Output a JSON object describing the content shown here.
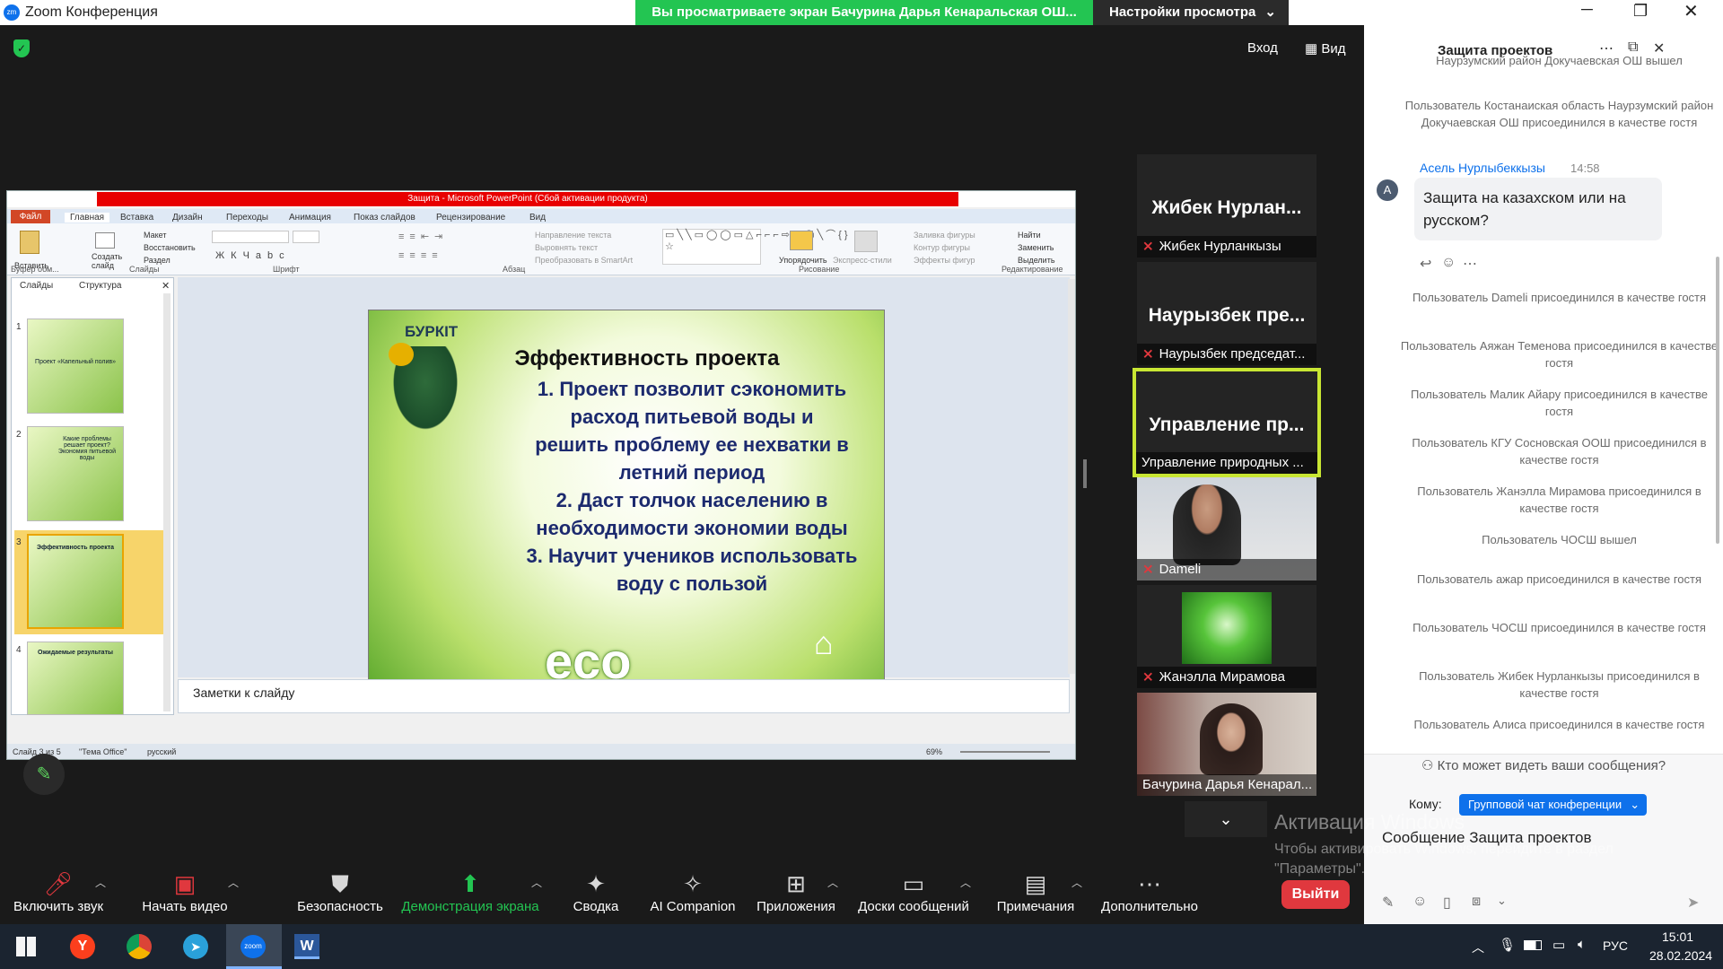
{
  "window": {
    "title": "Zoom Конференция",
    "share_banner": "Вы просматриваете экран Бачурина Дарья Кенаральская ОШ...",
    "view_settings": "Настройки просмотра",
    "enter_label": "Вход",
    "view_label": "Вид"
  },
  "ppt": {
    "title": "Защита - Microsoft PowerPoint (Сбой активации продукта)",
    "tabs": [
      "Файл",
      "Главная",
      "Вставка",
      "Дизайн",
      "Переходы",
      "Анимация",
      "Показ слайдов",
      "Рецензирование",
      "Вид"
    ],
    "group_labels": [
      "Буфер обм...",
      "Слайды",
      "Шрифт",
      "Абзац",
      "Рисование",
      "Редактирование"
    ],
    "panel_tabs": [
      "Слайды",
      "Структура"
    ],
    "ribbon": {
      "paste": "Вставить",
      "create_slide": "Создать слайд",
      "layout": "Макет",
      "restore": "Восстановить",
      "section": "Раздел",
      "text_direction": "Направление текста",
      "align_text": "Выровнять текст",
      "smartart": "Преобразовать в SmartArt",
      "arrange": "Упорядочить",
      "quick_styles": "Экспресс-стили",
      "shape_fill": "Заливка фигуры",
      "shape_outline": "Контур фигуры",
      "shape_effects": "Эффекты фигур",
      "find": "Найти",
      "replace": "Заменить",
      "select": "Выделить"
    },
    "thumbs": [
      {
        "num": "1",
        "text": "Проект «Капельный полив»"
      },
      {
        "num": "2",
        "text": "Какие проблемы решает проект? Экономия питьевой воды"
      },
      {
        "num": "3",
        "text": "Эффективность проекта"
      },
      {
        "num": "4",
        "text": "Ожидаемые результаты"
      }
    ],
    "slide": {
      "logo": "БУРКІТ",
      "title": "Эффективность проекта",
      "lines": [
        "1.  Проект позволит сэкономить",
        "расход питьевой воды и",
        "решить проблему ее нехватки в",
        "летний период",
        "2.  Даст толчок населению в",
        "необходимости экономии воды",
        "3.  Научит учеников использовать",
        "воду с пользой"
      ],
      "eco": "eco"
    },
    "notes": "Заметки к слайду",
    "status": {
      "slide": "Слайд 3 из 5",
      "theme": "\"Тема Office\"",
      "lang": "русский",
      "zoom": "69%"
    }
  },
  "participants": [
    {
      "big": "Жибек Нурлан...",
      "name": "Жибек Нурланкызы"
    },
    {
      "big": "Наурызбек пре...",
      "name": "Наурызбек председат..."
    },
    {
      "big": "Управление пр...",
      "name": "Управление природных ..."
    },
    {
      "name": "Dameli"
    },
    {
      "name": "Жанэлла Мирамова"
    },
    {
      "name": "Бачурина Дарья Кенарал..."
    }
  ],
  "chat": {
    "title": "Защита проектов",
    "sender": "Асель Нурлыбеккызы",
    "time": "14:58",
    "avatar": "А",
    "message": "Защита на казахском или на русском?",
    "messages": [
      "Наурзумский район Докучаевская ОШ вышел",
      "Пользователь Костанаиская область Наурзумский район Докучаевская ОШ присоединился в качестве гостя",
      "Пользователь Dameli присоединился в качестве гостя",
      "Пользователь Аяжан Теменова присоединился в качестве гостя",
      "Пользователь Малик Айару присоединился в качестве гостя",
      "Пользователь КГУ Сосновская ООШ присоединился в качестве гостя",
      "Пользователь Жанэлла Мирамова присоединился в качестве гостя",
      "Пользователь ЧОСШ вышел",
      "Пользователь ажар присоединился в качестве гостя",
      "Пользователь ЧОСШ присоединился в качестве гостя",
      "Пользователь Жибек Нурланкызы присоединился в качестве гостя",
      "Пользователь Алиса присоединился в качестве гостя"
    ],
    "who_can_see": "Кто может видеть ваши сообщения?",
    "to_label": "Кому:",
    "to_value": "Групповой чат конференции",
    "placeholder": "Сообщение Защита проектов"
  },
  "activation": {
    "title": "Активация Windows",
    "text": "Чтобы активировать Windows, перейдите в раздел \"Параметры\"."
  },
  "toolbar": {
    "mic": "Включить звук",
    "video": "Начать видео",
    "security": "Безопасность",
    "share": "Демонстрация экрана",
    "summary": "Сводка",
    "ai": "AI Companion",
    "apps": "Приложения",
    "boards": "Доски сообщений",
    "notes": "Примечания",
    "more": "Дополнительно",
    "leave": "Выйти"
  },
  "taskbar": {
    "lang": "РУС",
    "time": "15:01",
    "date": "28.02.2024",
    "zoom_label": "zoom"
  },
  "colors": {
    "share_green": "#23c552",
    "zoom_blue": "#0e71eb",
    "leave_red": "#e0383e"
  }
}
